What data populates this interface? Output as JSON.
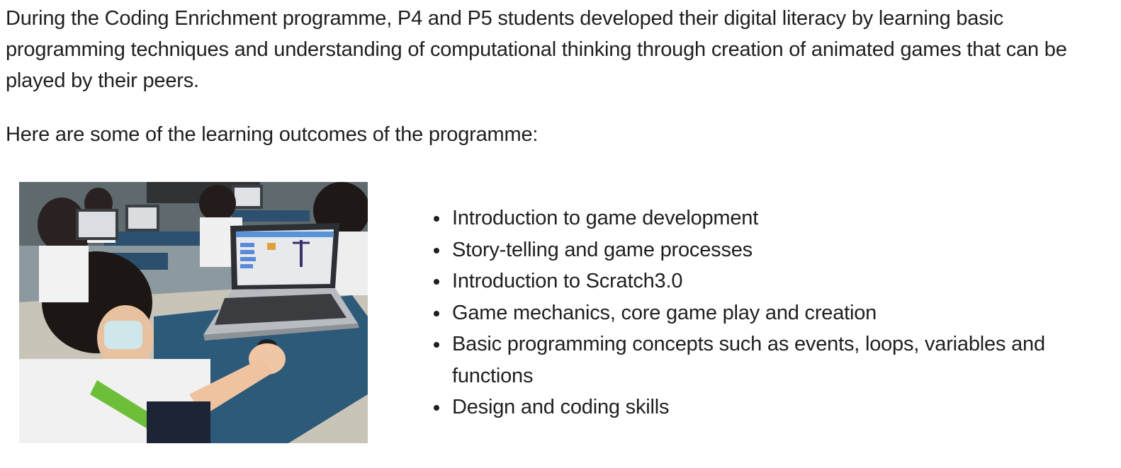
{
  "intro_paragraph": "During the Coding Enrichment programme, P4 and P5 students developed their digital literacy by learning basic programming techniques and understanding of computational thinking through creation of animated games that can be played by their peers.",
  "outcomes_heading": "Here are some of the learning outcomes of the programme:",
  "photo": {
    "subject": "students in a classroom working on laptops with a Scratch project open"
  },
  "outcomes": [
    "Introduction to game development",
    "Story-telling and game processes",
    "Introduction to Scratch3.0",
    "Game mechanics, core game play and creation",
    "Basic programming concepts such as events, loops, variables and functions",
    "Design and coding skills"
  ]
}
